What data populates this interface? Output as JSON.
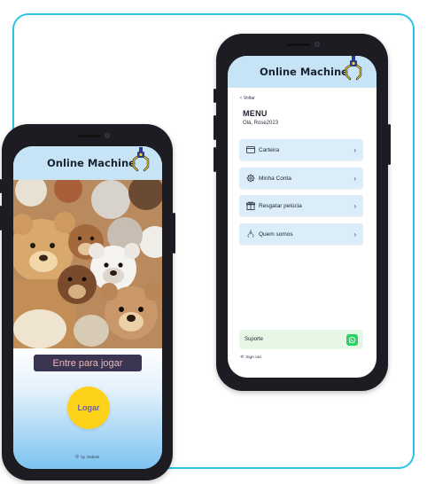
{
  "app": {
    "title": "Online Machine"
  },
  "left_screen": {
    "cta_label": "Entre para jogar",
    "login_label": "Logar",
    "footer_by": "by",
    "footer_brand": "Robots"
  },
  "right_screen": {
    "back_label": "Voltar",
    "menu_title": "MENU",
    "greeting": "Olá, Rose2023",
    "menu_items": [
      {
        "label": "Carteira",
        "icon": "wallet-icon"
      },
      {
        "label": "Minha Conta",
        "icon": "gear-icon"
      },
      {
        "label": "Resgatar pelúcia",
        "icon": "gift-icon"
      },
      {
        "label": "Quem somos",
        "icon": "claw-icon"
      }
    ],
    "support_label": "Suporte",
    "signout_label": "Sign out"
  },
  "colors": {
    "frame": "#2cc3ea",
    "header": "#c6e4f6",
    "menu_item_bg": "#dcedfa",
    "support_bg": "#e7f7e5",
    "login_button": "#ffd21a",
    "cta_pill": "#3a3550",
    "whatsapp": "#2bd366"
  }
}
